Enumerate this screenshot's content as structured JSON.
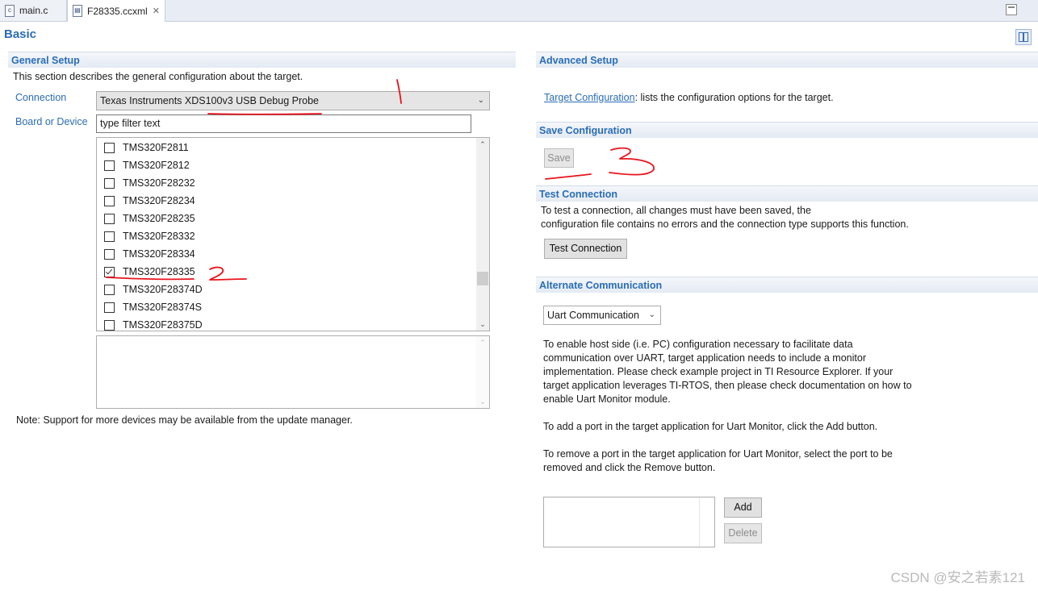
{
  "tabs": [
    {
      "label": "main.c",
      "icon": "c-file-icon"
    },
    {
      "label": "F28335.ccxml",
      "icon": "ccxml-file-icon"
    }
  ],
  "page_title": "Basic",
  "general_setup": {
    "title": "General Setup",
    "description": "This section describes the general configuration about the target.",
    "connection_label": "Connection",
    "connection_value": "Texas Instruments XDS100v3 USB Debug Probe",
    "board_label": "Board or Device",
    "filter_placeholder": "type filter text",
    "devices": [
      {
        "name": "TMS320F2811",
        "checked": false
      },
      {
        "name": "TMS320F2812",
        "checked": false
      },
      {
        "name": "TMS320F28232",
        "checked": false
      },
      {
        "name": "TMS320F28234",
        "checked": false
      },
      {
        "name": "TMS320F28235",
        "checked": false
      },
      {
        "name": "TMS320F28332",
        "checked": false
      },
      {
        "name": "TMS320F28334",
        "checked": false
      },
      {
        "name": "TMS320F28335",
        "checked": true
      },
      {
        "name": "TMS320F28374D",
        "checked": false
      },
      {
        "name": "TMS320F28374S",
        "checked": false
      },
      {
        "name": "TMS320F28375D",
        "checked": false
      }
    ],
    "note": "Note: Support for more devices may be available from the update manager."
  },
  "advanced_setup": {
    "title": "Advanced Setup",
    "link_text": "Target Configuration",
    "link_suffix": ": lists the configuration options for the target."
  },
  "save_configuration": {
    "title": "Save Configuration",
    "save_label": "Save"
  },
  "test_connection": {
    "title": "Test Connection",
    "line1": "To test a connection, all changes must have been saved, the",
    "line2": "configuration file contains no errors and the connection type supports this function.",
    "button_label": "Test Connection"
  },
  "alternate_communication": {
    "title": "Alternate Communication",
    "select_value": "Uart Communication",
    "para1": [
      "To enable host side (i.e. PC) configuration necessary to facilitate data",
      "communication over UART, target application needs to include a monitor",
      "implementation. Please check example project in TI Resource Explorer. If your",
      "target application leverages TI-RTOS, then please check documentation on how to",
      "enable Uart Monitor module."
    ],
    "para2": "To add a port in the target application for Uart Monitor, click the Add button.",
    "para3": [
      "To remove a port in the target application for Uart Monitor, select the port to be",
      "removed and click the Remove button."
    ],
    "add_label": "Add",
    "delete_label": "Delete"
  },
  "watermark": "CSDN @安之若素121",
  "colors": {
    "accent": "#2a6db5",
    "annotation": "#e8141c"
  }
}
